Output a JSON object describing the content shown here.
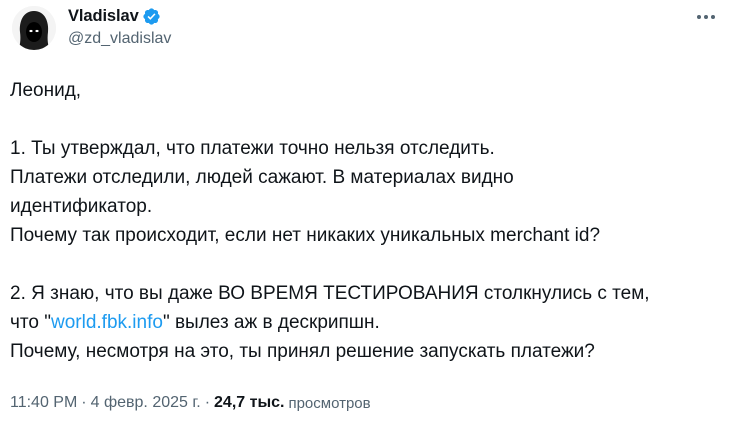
{
  "author": {
    "display_name": "Vladislav",
    "handle": "@zd_vladislav",
    "verified": true,
    "avatar_icon": "hooded-figure-avatar",
    "verified_icon": "verified-badge-icon",
    "verified_color": "#1d9bf0"
  },
  "menu": {
    "icon": "more-horizontal-icon"
  },
  "tweet": {
    "greeting": "Леонид,",
    "p1_line1": "1. Ты утверждал, что платежи точно нельзя отследить.",
    "p1_line2": "Платежи отследили, людей сажают. В материалах видно",
    "p1_line3": "идентификатор.",
    "p1_line4": "Почему так происходит, если нет никаких уникальных merchant id?",
    "p2_line1": "2. Я знаю, что вы даже ВО ВРЕМЯ ТЕСТИРОВАНИЯ столкнулись с тем,",
    "p2_line2_pre": "что \"",
    "p2_link": "world.fbk.info",
    "p2_line2_post": "\" вылез аж в дескрипшн.",
    "p2_line3": "Почему, несмотря на это, ты принял решение запускать платежи?"
  },
  "meta": {
    "time": "11:40 PM",
    "separator": "·",
    "date": "4 февр. 2025 г.",
    "views_count": "24,7 тыс.",
    "views_label": "просмотров"
  },
  "colors": {
    "text": "#0f1419",
    "secondary": "#536471",
    "link": "#1d9bf0"
  }
}
